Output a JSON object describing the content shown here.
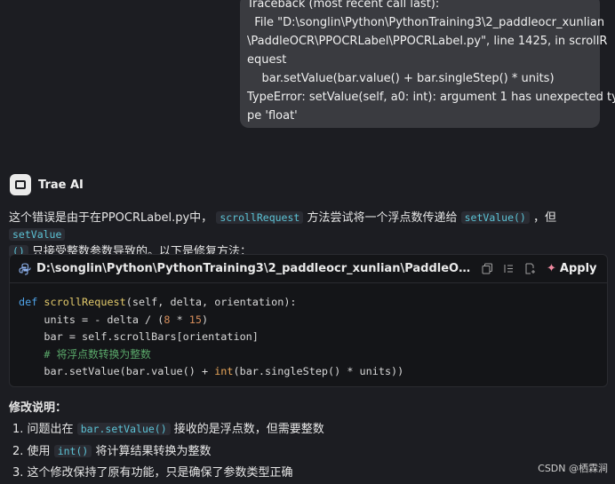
{
  "user_message": {
    "lines": [
      "Traceback (most recent call last):",
      "  File \"D:\\songlin\\Python\\PythonTraining3\\2_paddleocr_xunlian",
      "\\PaddleOCR\\PPOCRLabel\\PPOCRLabel.py\", line 1425, in scrollR",
      "equest",
      "    bar.setValue(bar.value() + bar.singleStep() * units)",
      "TypeError: setValue(self, a0: int): argument 1 has unexpected ty",
      "pe 'float'"
    ]
  },
  "assistant": {
    "name": "Trae AI",
    "intro": {
      "p1": "这个错误是由于在PPOCRLabel.py中，",
      "c1": "scrollRequest",
      "p2": "方法尝试将一个浮点数传递给",
      "c2": "setValue()",
      "p3": "，但",
      "c3": "setValue",
      "c4": "()",
      "p4": "只接受整数参数导致的。以下是修复方法："
    },
    "code_block": {
      "file_path": "D:\\songlin\\Python\\PythonTraining3\\2_paddleocr_xunlian\\PaddleOCR\\PPOCRLabel\\PPOCRLabel.py",
      "apply_label": "Apply",
      "code": {
        "l1_kw": "def",
        "l1_fn": "scrollRequest",
        "l1_rest": "(self, delta, orientation):",
        "l2_a": "    units = - delta / (",
        "l2_n1": "8",
        "l2_b": " * ",
        "l2_n2": "15",
        "l2_c": ")",
        "l3": "    bar = self.scrollBars[orientation]",
        "l4": "    # 将浮点数转换为整数",
        "l5_a": "    bar.setValue(bar.value() + ",
        "l5_bi": "int",
        "l5_b": "(bar.singleStep() * units))"
      }
    },
    "fix_title": "修改说明：",
    "fixes": [
      {
        "num": "1.",
        "pre": "问题出在",
        "code": "bar.setValue()",
        "post": "接收的是浮点数，但需要整数"
      },
      {
        "num": "2.",
        "pre": "使用",
        "code": "int()",
        "post": "将计算结果转换为整数"
      },
      {
        "num": "3.",
        "pre": "这个修改保持了原有功能，只是确保了参数类型正确",
        "code": "",
        "post": ""
      }
    ]
  },
  "watermark": "CSDN @栖霖涧",
  "colors": {
    "background": "#1c1d22",
    "bubble": "#3a3b40",
    "inline_code": "#5cc3d6",
    "keyword": "#4fa3e8",
    "comment": "#5aa86a"
  }
}
